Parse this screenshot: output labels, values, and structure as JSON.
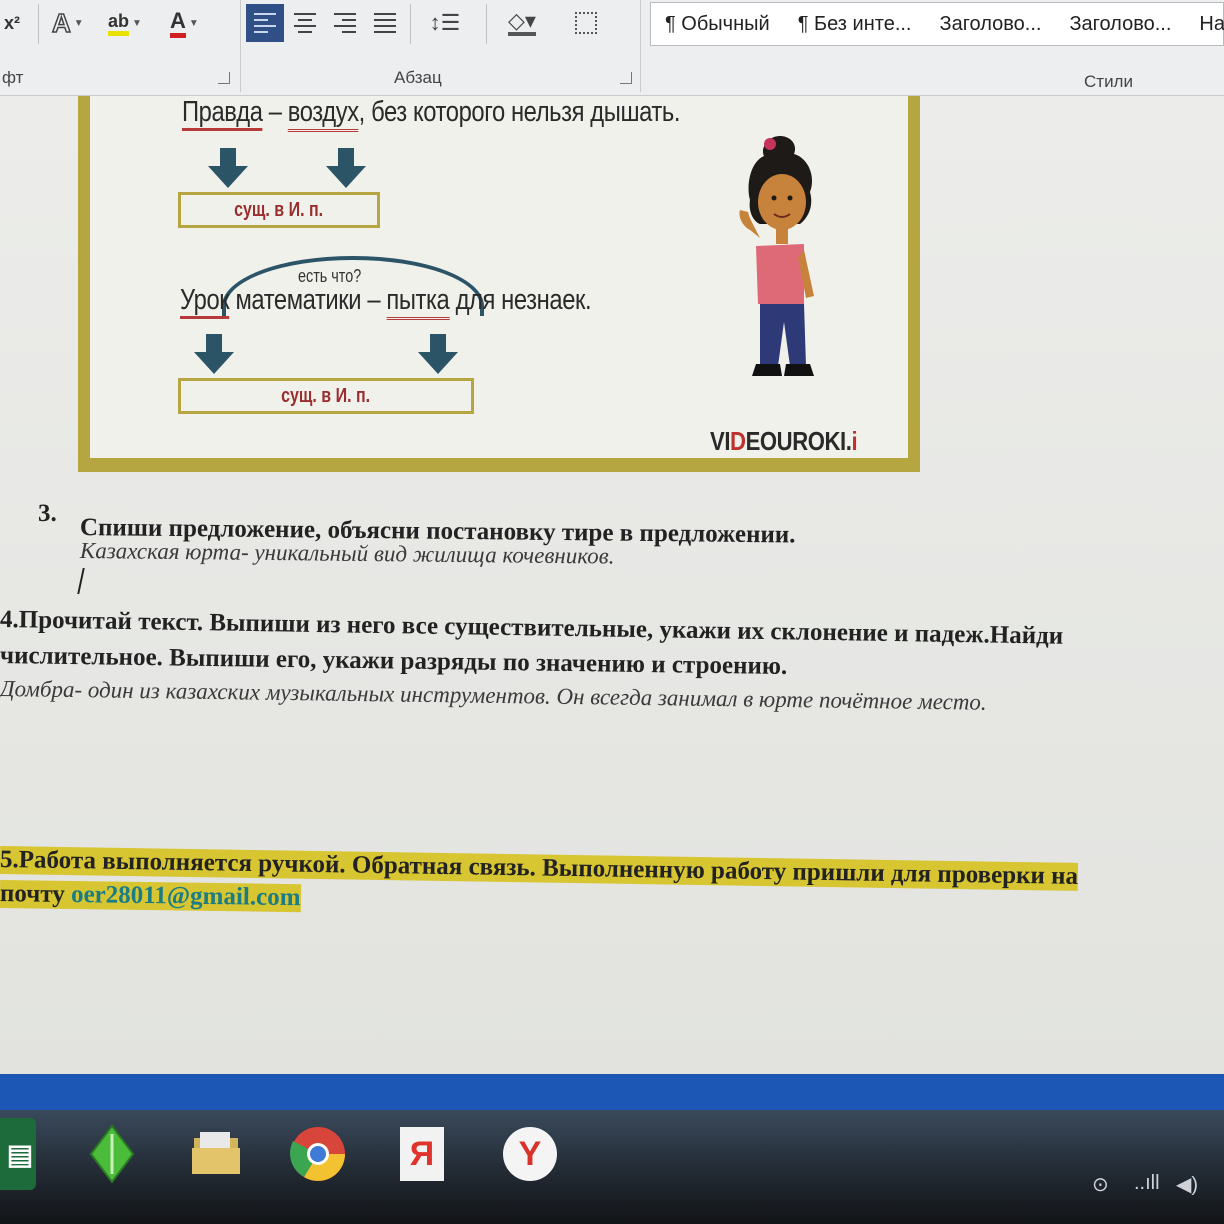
{
  "ribbon": {
    "superscript_label": "x²",
    "text_effects_label": "A",
    "highlight_label": "ab",
    "font_color_label": "A",
    "groups": {
      "font": "фт",
      "paragraph": "Абзац",
      "styles": "Стили"
    },
    "styles": [
      "¶ Обычный",
      "¶ Без инте...",
      "Заголово...",
      "Заголово...",
      "На"
    ]
  },
  "figure": {
    "sentence1": {
      "w1": "Правда",
      "dash": " – ",
      "w2": "воздух",
      "rest": ", без которого нельзя дышать."
    },
    "box1": "сущ. в И. п.",
    "question": "есть что?",
    "sentence2": {
      "w1": "Урок",
      "mid": " математики – ",
      "w2": "пытка",
      "rest": " для незнаек."
    },
    "box2": "сущ. в И. п.",
    "logo_prefix": "VI",
    "logo_accent": "D",
    "logo_suffix": "EOUROKI.",
    "logo_tld": "i"
  },
  "document": {
    "task3_number": "3.",
    "task3_title": "Спиши предложение, объясни постановку тире в предложении.",
    "task3_example": "Казахская юрта- уникальный вид жилища кочевников.",
    "task4_line1": "4.Прочитай текст. Выпиши из него все существительные, укажи их склонение и падеж.Найди",
    "task4_line2": "числительное. Выпиши его, укажи разряды по значению и строению.",
    "task4_example": "Домбра- один из казахских музыкальных инструментов. Он всегда занимал в юрте почётное место.",
    "task5_line1": "5.Работа выполняется ручкой. Обратная связь. Выполненную работу пришли для проверки на",
    "task5_line2_prefix": "почту ",
    "task5_email": "oer28011@gmail.com"
  },
  "colors": {
    "frame": "#b5a642",
    "arrow": "#2b5467",
    "underline": "#b73a3a",
    "highlight": "#d7c531",
    "taskbar_stripe": "#1c57b5"
  },
  "taskbar": {
    "icons": [
      "excel-icon",
      "sims-icon",
      "files-icon",
      "chrome-icon",
      "yandex-icon",
      "yandex-browser-icon"
    ],
    "yandex_label": "Я",
    "yandex_browser_label": "Y",
    "tray": {
      "signal": "..ıll",
      "volume": "◀)"
    }
  }
}
